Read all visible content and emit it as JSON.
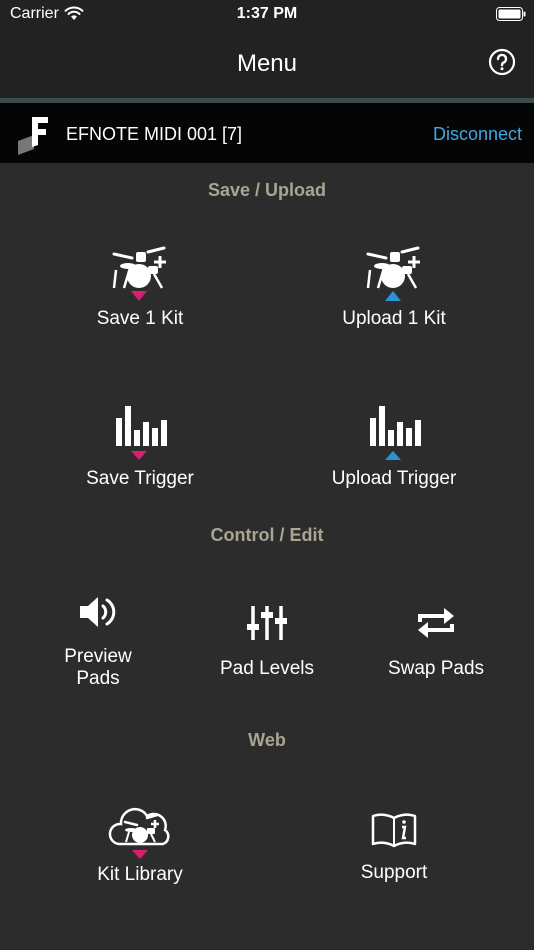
{
  "status_bar": {
    "carrier": "Carrier",
    "time": "1:37 PM",
    "wifi_icon": "wifi-icon",
    "battery_icon": "battery-icon"
  },
  "nav": {
    "title": "Menu",
    "help_icon": "question-circle-icon"
  },
  "device": {
    "name": "EFNOTE MIDI 001 [7]",
    "disconnect_label": "Disconnect",
    "logo_icon": "efnote-logo-icon"
  },
  "sections": {
    "save_upload": "Save / Upload",
    "control_edit": "Control / Edit",
    "web": "Web"
  },
  "items": {
    "save_kit": {
      "label": "Save 1 Kit",
      "icon": "drum-kit-save-icon"
    },
    "upload_kit": {
      "label": "Upload 1 Kit",
      "icon": "drum-kit-upload-icon"
    },
    "save_trigger": {
      "label": "Save Trigger",
      "icon": "trigger-bars-save-icon"
    },
    "upload_trigger": {
      "label": "Upload Trigger",
      "icon": "trigger-bars-upload-icon"
    },
    "preview_pads": {
      "label": "Preview\nPads",
      "line1": "Preview",
      "line2": "Pads",
      "icon": "speaker-icon"
    },
    "pad_levels": {
      "label": "Pad Levels",
      "icon": "sliders-icon"
    },
    "swap_pads": {
      "label": "Swap Pads",
      "icon": "swap-arrows-icon"
    },
    "kit_library": {
      "label": "Kit Library",
      "icon": "cloud-drum-kit-icon"
    },
    "support": {
      "label": "Support",
      "icon": "book-info-icon"
    }
  },
  "colors": {
    "background": "#2c2c2c",
    "bar": "#222222",
    "device_bar": "#050505",
    "accent_link": "#3fa9e5",
    "save_arrow": "#d6206f",
    "upload_arrow": "#2a93d5",
    "section_header": "#a9a593"
  }
}
